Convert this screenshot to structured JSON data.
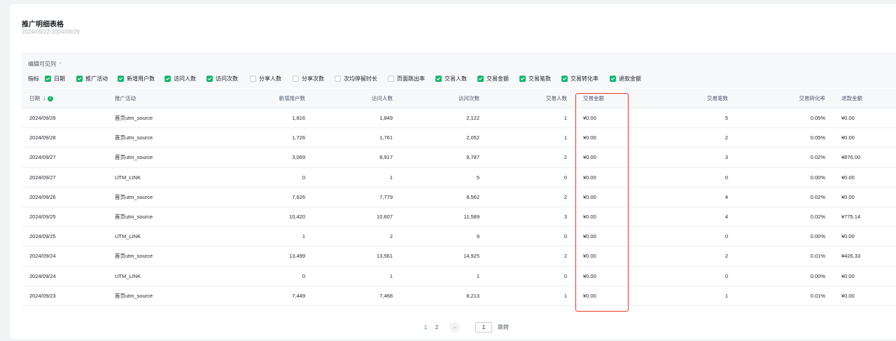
{
  "header": {
    "title": "推广明细表格",
    "date_range": "2024/09/22-2024/09/29"
  },
  "columns_panel": {
    "edit_label": "编辑可见列",
    "metrics_label": "指标",
    "metrics": [
      {
        "label": "日期",
        "checked": true
      },
      {
        "label": "推广活动",
        "checked": true
      },
      {
        "label": "新增用户数",
        "checked": true
      },
      {
        "label": "访问人数",
        "checked": true
      },
      {
        "label": "访问次数",
        "checked": true
      },
      {
        "label": "分享人数",
        "checked": false
      },
      {
        "label": "分享次数",
        "checked": false
      },
      {
        "label": "次均停留时长",
        "checked": false
      },
      {
        "label": "页面跳出率",
        "checked": false
      },
      {
        "label": "交易人数",
        "checked": true
      },
      {
        "label": "交易金额",
        "checked": true
      },
      {
        "label": "交易笔数",
        "checked": true
      },
      {
        "label": "交易转化率",
        "checked": true
      },
      {
        "label": "退款金额",
        "checked": true
      }
    ]
  },
  "table": {
    "headers": [
      "日期",
      "推广活动",
      "新增用户数",
      "访问人数",
      "访问次数",
      "交易人数",
      "交易金额",
      "交易笔数",
      "交易转化率",
      "退款金额"
    ],
    "info_glyph": "!",
    "rows": [
      [
        "2024/09/29",
        "首页utm_source",
        "1,816",
        "1,849",
        "2,122",
        "1",
        "¥0.00",
        "5",
        "0.05%",
        "¥0.00"
      ],
      [
        "2024/09/28",
        "首页utm_source",
        "1,726",
        "1,761",
        "2,052",
        "1",
        "¥0.00",
        "2",
        "0.05%",
        "¥0.00"
      ],
      [
        "2024/09/27",
        "首页utm_source",
        "3,069",
        "8,917",
        "9,787",
        "2",
        "¥0.00",
        "3",
        "0.02%",
        "¥876.00"
      ],
      [
        "2024/09/27",
        "UTM_LINK",
        "0",
        "1",
        "5",
        "0",
        "¥0.00",
        "0",
        "0.00%",
        "¥0.00"
      ],
      [
        "2024/09/26",
        "首页utm_source",
        "7,626",
        "7,779",
        "8,562",
        "2",
        "¥0.00",
        "4",
        "0.02%",
        "¥0.00"
      ],
      [
        "2024/09/25",
        "首页utm_source",
        "10,420",
        "10,607",
        "11,589",
        "3",
        "¥0.00",
        "4",
        "0.02%",
        "¥775.14"
      ],
      [
        "2024/09/25",
        "UTM_LINK",
        "1",
        "2",
        "9",
        "0",
        "¥0.00",
        "0",
        "0.00%",
        "¥0.00"
      ],
      [
        "2024/09/24",
        "首页utm_source",
        "13,499",
        "13,561",
        "14,925",
        "2",
        "¥0.00",
        "2",
        "0.01%",
        "¥426.33"
      ],
      [
        "2024/09/24",
        "UTM_LINK",
        "0",
        "1",
        "1",
        "0",
        "¥0.00",
        "0",
        "0.00%",
        "¥0.00"
      ],
      [
        "2024/09/23",
        "首页utm_source",
        "7,449",
        "7,468",
        "8,213",
        "1",
        "¥0.00",
        "1",
        "0.01%",
        "¥0.00"
      ]
    ]
  },
  "pagination": {
    "pages": [
      "1",
      "2"
    ],
    "current": "1",
    "jump_value": "1",
    "jump_label": "跳转",
    "next_glyph": "›"
  },
  "colors": {
    "accent": "#12b76a",
    "highlight": "#e5372b"
  }
}
